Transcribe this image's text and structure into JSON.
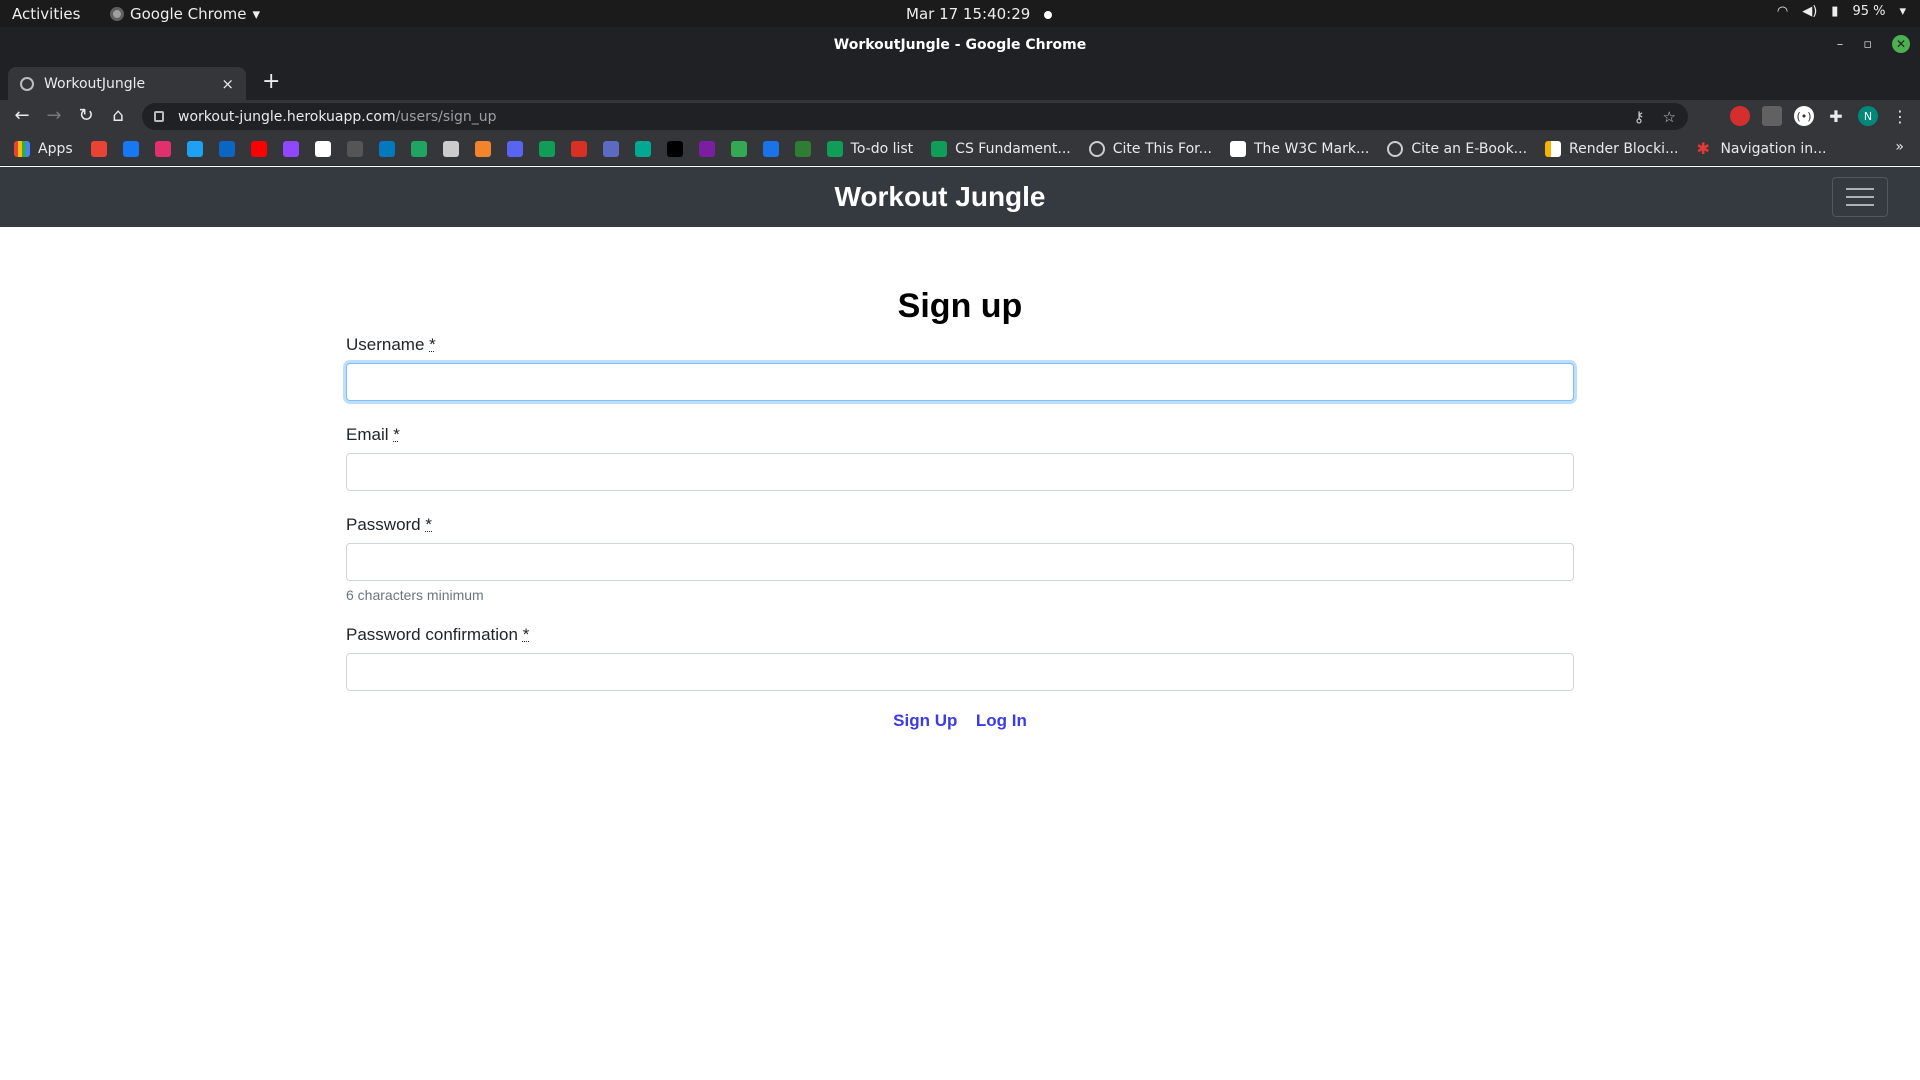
{
  "os_bar": {
    "activities": "Activities",
    "app_name": "Google Chrome",
    "clock": "Mar 17  15:40:29",
    "battery": "95 %"
  },
  "window": {
    "title": "WorkoutJungle - Google Chrome"
  },
  "tab": {
    "label": "WorkoutJungle",
    "close": "×",
    "new_tab": "+"
  },
  "omnibox": {
    "host": "workout-jungle.herokuapp.com",
    "path": "/users/sign_up"
  },
  "bookmarks": {
    "apps": "Apps",
    "items": [
      "To-do list",
      "CS Fundament...",
      "Cite This For...",
      "The W3C Mark...",
      "Cite an E-Book...",
      "Render Blocki...",
      "Navigation in..."
    ],
    "more": "»",
    "icon_colors": [
      "#ea4335",
      "#1877f2",
      "#e1306c",
      "#1da1f2",
      "#0a66c2",
      "#ff0000",
      "#9146ff",
      "#ffffff",
      "#555555",
      "#0079bf",
      "#1fa463",
      "#cccccc",
      "#f2842c",
      "#5865f2",
      "#0f9d58",
      "#d93025",
      "#5c6bc0",
      "#00a98f",
      "#000000",
      "#7b1fa2",
      "#34a853",
      "#1a73e8",
      "#2e7d32"
    ]
  },
  "site": {
    "brand": "Workout Jungle"
  },
  "form": {
    "title": "Sign up",
    "required_mark": "*",
    "username_label": "Username",
    "email_label": "Email",
    "password_label": "Password",
    "password_hint": "6 characters minimum",
    "password_confirmation_label": "Password confirmation",
    "username_value": "",
    "email_value": "",
    "password_value": "",
    "password_confirmation_value": ""
  },
  "actions": {
    "sign_up": "Sign Up",
    "log_in": "Log In"
  },
  "colors": {
    "navbar": "#343a40",
    "link": "#3b3be8",
    "focus_border": "#80bdff"
  }
}
